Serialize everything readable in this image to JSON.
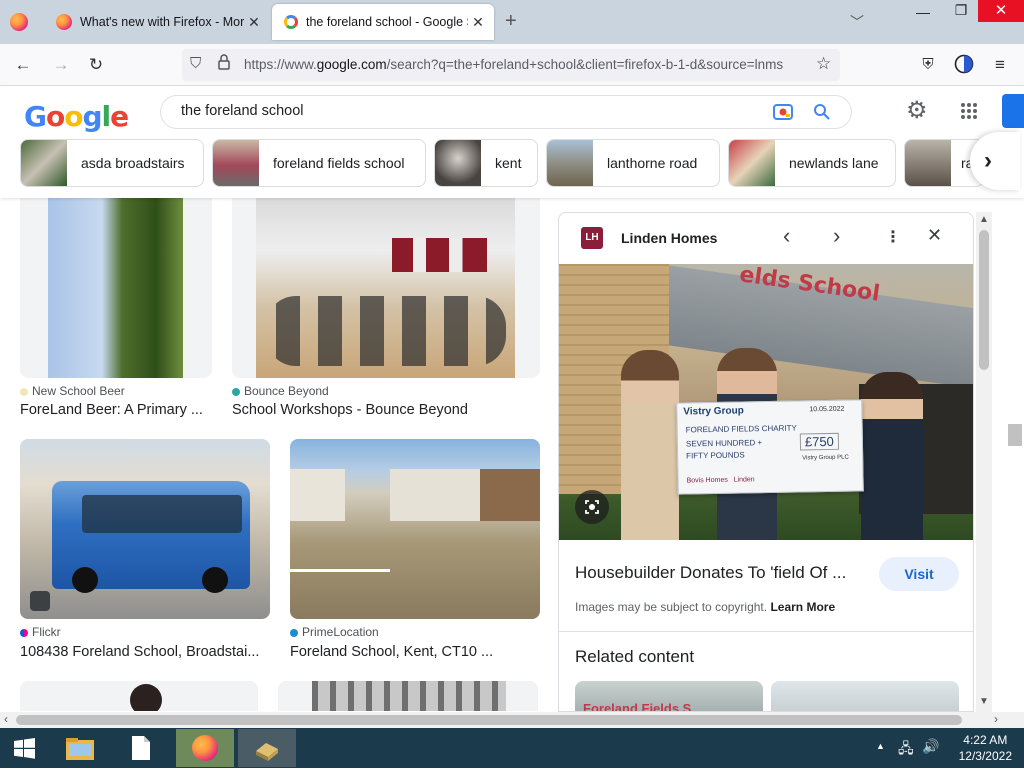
{
  "browser": {
    "tabs": [
      {
        "title": "What's new with Firefox - More",
        "icon": "firefox-icon",
        "active": false
      },
      {
        "title": "the foreland school - Google Se",
        "icon": "google-icon",
        "active": true
      }
    ],
    "new_tab": "+",
    "url": "https://www.",
    "url_domain": "google.com",
    "url_rest": "/search?q=the+foreland+school&client=firefox-b-1-d&source=lnms"
  },
  "google": {
    "logo": [
      "G",
      "o",
      "o",
      "g",
      "l",
      "e"
    ],
    "query": "the foreland school",
    "chips": [
      "asda broadstairs",
      "foreland fields school",
      "kent",
      "lanthorne road",
      "newlands lane",
      "ra"
    ]
  },
  "results": [
    {
      "source": "New School Beer",
      "caption": "ForeLand Beer: A Primary ..."
    },
    {
      "source": "Bounce Beyond",
      "caption": "School Workshops - Bounce Beyond"
    },
    {
      "source": "Flickr",
      "caption": "108438 Foreland School, Broadstai..."
    },
    {
      "source": "PrimeLocation",
      "caption": "Foreland School, Kent, CT10 ..."
    }
  ],
  "panel": {
    "badge": "LH",
    "site": "Linden Homes",
    "sign": "elds School",
    "cheque": {
      "bank": "Vistry Group",
      "date": "10.05.2022",
      "payee": "FORELAND FIELDS CHARITY",
      "words1": "SEVEN HUNDRED +",
      "words2": "FIFTY POUNDS",
      "amount": "£750",
      "sig": "Vistry Group PLC",
      "brands": "Bovis Homes   Linden"
    },
    "title": "Housebuilder Donates To 'field Of ...",
    "visit": "Visit",
    "copyright": "Images may be subject to copyright.",
    "learn_more": "Learn More",
    "related": "Related content",
    "related_thumb_text": "Foreland Fields S"
  },
  "taskbar": {
    "time": "4:22 AM",
    "date": "12/3/2022"
  },
  "colors": {
    "google_blue": "#4285f4",
    "google_red": "#ea4335",
    "google_yellow": "#fbbc05",
    "google_green": "#34a853",
    "taskbar": "#1b3a4b",
    "tabbar": "#c9d4de"
  }
}
